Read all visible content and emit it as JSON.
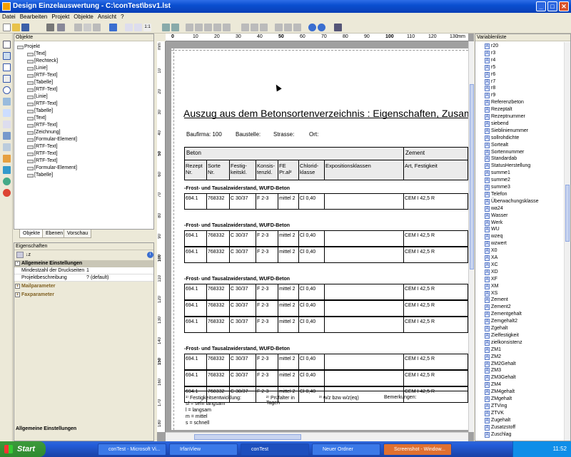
{
  "window": {
    "title": "Design Einzelauswertung - C:\\conTest\\bsv1.lst"
  },
  "menu": [
    "Datei",
    "Bearbeiten",
    "Projekt",
    "Objekte",
    "Ansicht",
    "?"
  ],
  "objects_panel": {
    "title": "Objekte",
    "root": "Projekt",
    "items": [
      "[Text]",
      "[Rechteck]",
      "[Linie]",
      "[RTF-Text]",
      "[Tabelle]",
      "[RTF-Text]",
      "[Linie]",
      "[RTF-Text]",
      "[Tabelle]",
      "[Text]",
      "[RTF-Text]",
      "[Zeichnung]",
      "[Formular-Element]",
      "[RTF-Text]",
      "[RTF-Text]",
      "[RTF-Text]",
      "[Formular-Element]",
      "[Tabelle]"
    ],
    "tabs": [
      "Objekte",
      "Ebenen",
      "Vorschau"
    ]
  },
  "properties_panel": {
    "title": "Eigenschaften",
    "groups": {
      "general": "Allgemeine Einstellungen",
      "mail": "Mailparameter",
      "fax": "Faxparameter"
    },
    "rows": [
      {
        "label": "Mindestzahl der Druckseiten",
        "value": "1"
      },
      {
        "label": "Projektbeschreibung",
        "value": "? (default)"
      }
    ],
    "footer": "Allgemeine Einstellungen"
  },
  "ruler": {
    "unit": "mm",
    "labels": [
      "0",
      "10",
      "20",
      "30",
      "40",
      "50",
      "60",
      "70",
      "80",
      "90",
      "100",
      "110",
      "120",
      "130"
    ],
    "vlabels": [
      "10",
      "20",
      "30",
      "40",
      "50",
      "60",
      "70",
      "80",
      "90",
      "100",
      "110",
      "120",
      "130",
      "140",
      "150",
      "160",
      "170",
      "180"
    ]
  },
  "report": {
    "title": "Auszug aus dem Betonsortenverzeichnis : Eigenschaften, Zusammensetzung",
    "info": {
      "firm_label": "Baufirma: 100",
      "site": "Baustelle:",
      "street": "Strasse:",
      "place": "Ort:"
    },
    "header_group": {
      "beton": "Beton",
      "zement": "Zement"
    },
    "columns": [
      "Rezept Nr.",
      "Sorte Nr.",
      "Festig-keitskl.",
      "Konsis-tenzkl.",
      "FE Pr.al²",
      "Chlorid-klasse",
      "Expositionsklassen",
      "Art, Festigkeit"
    ],
    "groups": [
      {
        "title": "-Frost- und Tausalzwiderstand, WUFD-Beton",
        "rows": [
          [
            "694.1",
            "768332",
            "C 30/37",
            "F 2-3",
            "mittel 2",
            "Cl 0,40",
            "",
            "CEM I 42,5 R"
          ]
        ]
      },
      {
        "title": "-Frost- und Tausalzwiderstand, WUFD-Beton",
        "rows": [
          [
            "694.1",
            "768332",
            "C 30/37",
            "F 2-3",
            "mittel 2",
            "Cl 0,40",
            "",
            "CEM I 42,5 R"
          ],
          [
            "694.1",
            "768332",
            "C 30/37",
            "F 2-3",
            "mittel 2",
            "Cl 0,40",
            "",
            "CEM I 42,5 R"
          ]
        ]
      },
      {
        "title": "-Frost- und Tausalzwiderstand, WUFD-Beton",
        "rows": [
          [
            "694.1",
            "768332",
            "C 30/37",
            "F 2-3",
            "mittel 2",
            "Cl 0,40",
            "",
            "CEM I 42,5 R"
          ],
          [
            "694.1",
            "768332",
            "C 30/37",
            "F 2-3",
            "mittel 2",
            "Cl 0,40",
            "",
            "CEM I 42,5 R"
          ],
          [
            "694.1",
            "768332",
            "C 30/37",
            "F 2-3",
            "mittel 2",
            "Cl 0,40",
            "",
            "CEM I 42,5 R"
          ]
        ]
      },
      {
        "title": "-Frost- und Tausalzwiderstand, WUFD-Beton",
        "rows": [
          [
            "694.1",
            "768332",
            "C 30/37",
            "F 2-3",
            "mittel 2",
            "Cl 0,40",
            "",
            "CEM I 42,5 R"
          ],
          [
            "694.1",
            "768332",
            "C 30/37",
            "F 2-3",
            "mittel 2",
            "Cl 0,40",
            "",
            "CEM I 42,5 R"
          ],
          [
            "694.1",
            "768332",
            "C 30/37",
            "F 2-3",
            "mittel 2",
            "Cl 0,40",
            "",
            "CEM I 42,5 R"
          ]
        ]
      }
    ],
    "footnotes": {
      "f1_title": "¹⁾ Festigkeitsentwicklung:",
      "f1_lines": [
        "sl = sehr langsam",
        "l = langsam",
        "m = mittel",
        "s = schnell"
      ],
      "f2": "²⁾ Prüfalter in Tagen",
      "f3": "³⁾ w/z bzw w/z(eq)",
      "remarks": "Bemerkungen:"
    }
  },
  "variables_panel": {
    "title": "Variablenliste",
    "items": [
      "r20",
      "r3",
      "r4",
      "r5",
      "r6",
      "r7",
      "r8",
      "r9",
      "Referenzbeton",
      "Rezeptalt",
      "Rezeptnummer",
      "siebend",
      "Sieblinienummer",
      "sollrohdichte",
      "Sortealt",
      "Sortennummer",
      "Standardab",
      "StatusHerstellung",
      "summe1",
      "summe2",
      "summe3",
      "Telefon",
      "Überwachungsklasse",
      "wa24",
      "Wasser",
      "Werk",
      "WU",
      "wzeq",
      "wzwert",
      "X0",
      "XA",
      "XC",
      "XD",
      "XF",
      "XM",
      "XS",
      "Zement",
      "Zement2",
      "Zementgehalt",
      "Zemgehalt2",
      "Zgehalt",
      "Zielfestigkeit",
      "zielkonsistenz",
      "ZM1",
      "ZM2",
      "ZM2Gehalt",
      "ZM3",
      "ZM3Gehalt",
      "ZM4",
      "ZM4gehalt",
      "ZMgehalt",
      "ZTVing",
      "ZTVK",
      "Zugehalt",
      "Zusatzstoff",
      "Zuschlag"
    ]
  },
  "taskbar": {
    "start": "Start",
    "tasks": [
      "conTest - Microsoft Vi...",
      "IrfanView",
      "conTest",
      "Neuer Ordner",
      "Screenshot - Window..."
    ],
    "clock": "11:52"
  }
}
